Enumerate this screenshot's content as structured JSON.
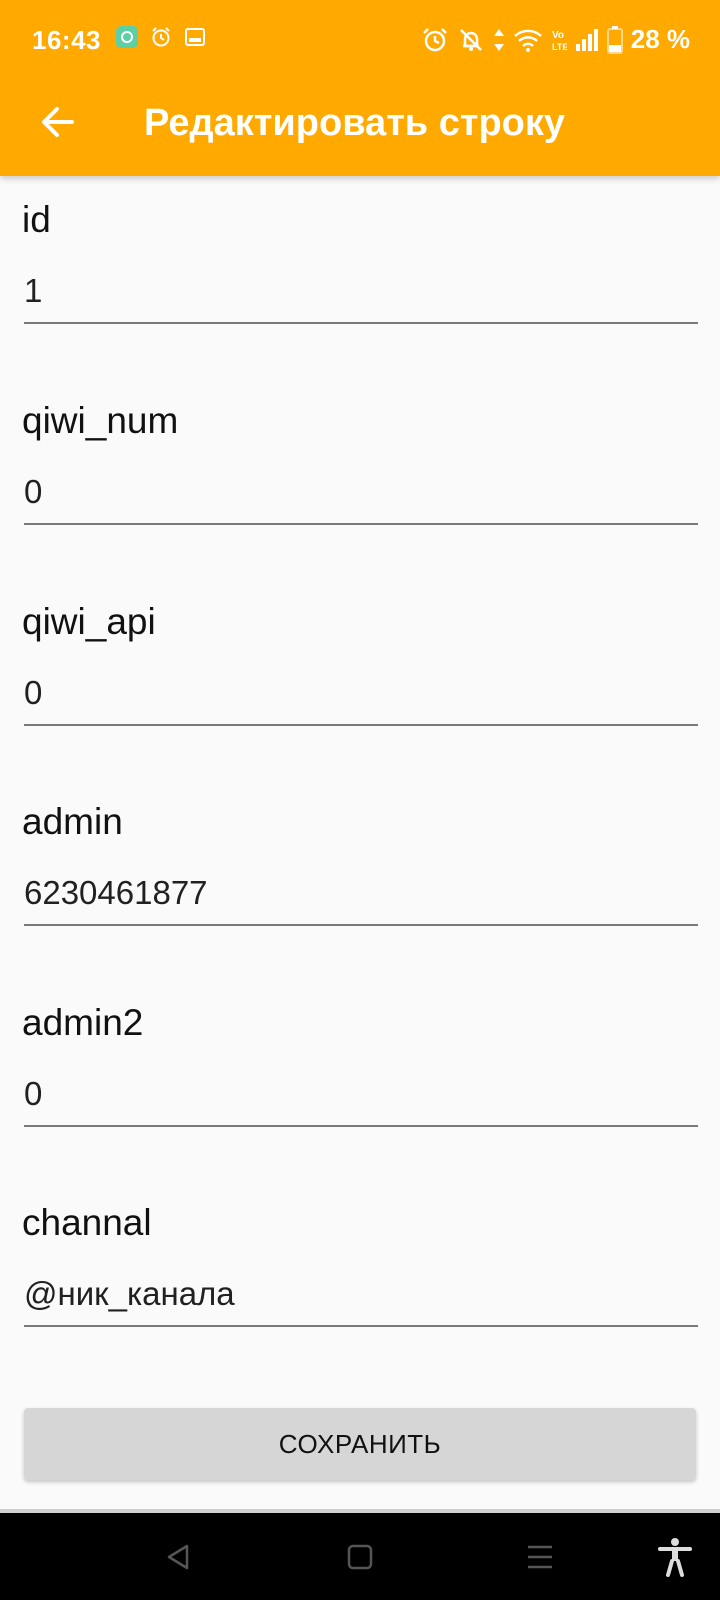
{
  "status_bar": {
    "time": "16:43",
    "battery": "28 %",
    "left_icons": [
      "app-notification-icon",
      "alarm-icon",
      "screenshot-icon"
    ],
    "right_icons": [
      "alarm-icon",
      "notifications-off-icon",
      "data-arrows-icon",
      "wifi-icon",
      "volte-icon",
      "signal-icon",
      "battery-icon"
    ]
  },
  "app_bar": {
    "title": "Редактировать строку",
    "back_icon": "arrow-back-icon",
    "color": "#ffa901"
  },
  "fields": [
    {
      "label": "id",
      "value": "1"
    },
    {
      "label": "qiwi_num",
      "value": "0"
    },
    {
      "label": "qiwi_api",
      "value": "0"
    },
    {
      "label": "admin",
      "value": "6230461877"
    },
    {
      "label": "admin2",
      "value": "0"
    },
    {
      "label": "channal",
      "value": "@ник_канала"
    }
  ],
  "save_button": {
    "label": "СОХРАНИТЬ"
  },
  "nav_bar": {
    "icons": [
      "back-triangle-icon",
      "home-square-icon",
      "recents-menu-icon",
      "accessibility-icon"
    ]
  }
}
